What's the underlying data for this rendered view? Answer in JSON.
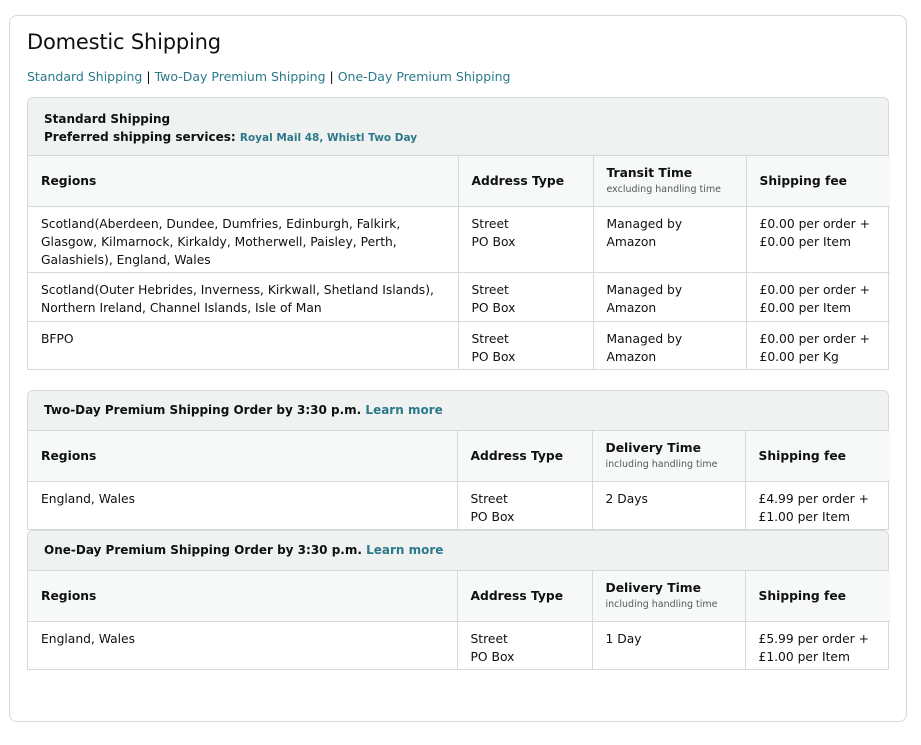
{
  "page": {
    "title": "Domestic Shipping"
  },
  "links": [
    "Standard Shipping",
    "Two-Day Premium Shipping",
    "One-Day Premium Shipping"
  ],
  "link_separator": "|",
  "standard": {
    "title": "Standard Shipping",
    "preferred_label": "Preferred shipping services:",
    "preferred_services": "Royal Mail 48, Whistl Two Day",
    "headers": {
      "regions": "Regions",
      "address_type": "Address Type",
      "time": "Transit Time",
      "time_sub": "excluding handling time",
      "fee": "Shipping fee"
    },
    "rows": [
      {
        "regions": "Scotland(Aberdeen, Dundee, Dumfries, Edinburgh, Falkirk, Glasgow, Kilmarnock, Kirkaldy, Motherwell, Paisley, Perth, Galashiels), England, Wales",
        "address_1": "Street",
        "address_2": "PO Box",
        "time": "Managed by Amazon",
        "fee_1": "£0.00 per order +",
        "fee_2": "£0.00 per Item"
      },
      {
        "regions": "Scotland(Outer Hebrides, Inverness, Kirkwall, Shetland Islands), Northern Ireland, Channel Islands, Isle of Man",
        "address_1": "Street",
        "address_2": "PO Box",
        "time": "Managed by Amazon",
        "fee_1": "£0.00 per order +",
        "fee_2": "£0.00 per Item"
      },
      {
        "regions": "BFPO",
        "address_1": "Street",
        "address_2": "PO Box",
        "time": "Managed by Amazon",
        "fee_1": "£0.00 per order +",
        "fee_2": "£0.00 per Kg"
      }
    ]
  },
  "two_day": {
    "title": "Two-Day Premium Shipping Order by 3:30 p.m.",
    "learn_more": "Learn more",
    "headers": {
      "regions": "Regions",
      "address_type": "Address Type",
      "time": "Delivery Time",
      "time_sub": "including handling time",
      "fee": "Shipping fee"
    },
    "rows": [
      {
        "regions": "England, Wales",
        "address_1": "Street",
        "address_2": "PO Box",
        "time": "2 Days",
        "fee_1": "£4.99 per order +",
        "fee_2": "£1.00 per Item"
      }
    ]
  },
  "one_day": {
    "title": "One-Day Premium Shipping Order by 3:30 p.m.",
    "learn_more": "Learn more",
    "headers": {
      "regions": "Regions",
      "address_type": "Address Type",
      "time": "Delivery Time",
      "time_sub": "including handling time",
      "fee": "Shipping fee"
    },
    "rows": [
      {
        "regions": "England, Wales",
        "address_1": "Street",
        "address_2": "PO Box",
        "time": "1 Day",
        "fee_1": "£5.99 per order +",
        "fee_2": "£1.00 per Item"
      }
    ]
  },
  "colors": {
    "link": "#2a7a8a",
    "header_bg": "#f0f2f2",
    "border": "#d5d9d9",
    "text": "#0f1111"
  }
}
